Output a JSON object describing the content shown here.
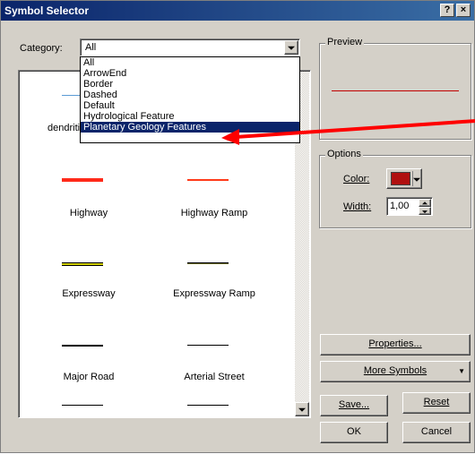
{
  "window": {
    "title": "Symbol Selector",
    "help_label": "?",
    "close_label": "×"
  },
  "category": {
    "label": "Category:",
    "value": "All",
    "options": [
      "All",
      "ArrowEnd",
      "Border",
      "Dashed",
      "Default",
      "Hydrological Feature",
      "Planetary Geology Features"
    ],
    "selected_index": 6
  },
  "symbols": [
    {
      "name": "dendritic",
      "color": "#5b9bd5",
      "thickness": "thin"
    },
    {
      "name": "Highway",
      "color": "#ff2a1a",
      "thickness": "thick"
    },
    {
      "name": "Highway Ramp",
      "color": "#ff3a1a",
      "thickness": "medium"
    },
    {
      "name": "Expressway",
      "color": "#cccc00",
      "thickness": "cased"
    },
    {
      "name": "Expressway Ramp",
      "color": "#6a6a00",
      "thickness": "thin-cased"
    },
    {
      "name": "Major Road",
      "color": "#000000",
      "thickness": "medium"
    },
    {
      "name": "Arterial Street",
      "color": "#000000",
      "thickness": "thin"
    },
    {
      "name": "",
      "color": "#000000",
      "thickness": "thin"
    },
    {
      "name": "",
      "color": "#000000",
      "thickness": "thin"
    }
  ],
  "preview": {
    "title": "Preview",
    "line_color": "#c00000"
  },
  "options": {
    "title": "Options",
    "color_label": "Color:",
    "color_value": "#b01010",
    "width_label": "Width:",
    "width_value": "1,00"
  },
  "buttons": {
    "properties": "Properties...",
    "more_symbols": "More Symbols",
    "save": "Save...",
    "reset": "Reset",
    "ok": "OK",
    "cancel": "Cancel"
  },
  "annotation": {
    "arrow_color": "#ff0000"
  }
}
